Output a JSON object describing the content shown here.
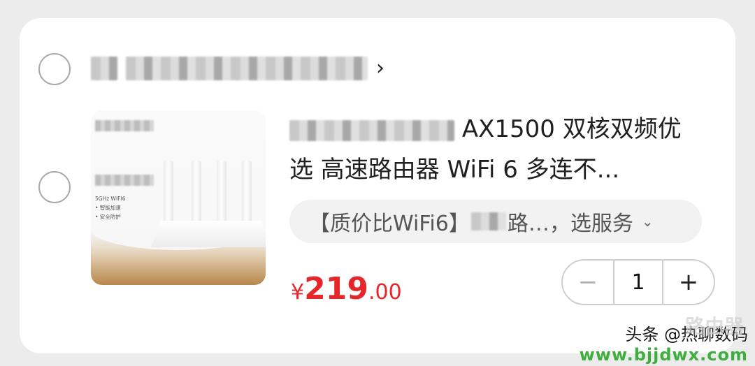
{
  "shop": {
    "chevron": "›"
  },
  "product": {
    "image_specs": [
      "5GHz WIFI6",
      "• 智能加速",
      "• 安全防护"
    ],
    "title_visible": "AX1500 双核双频优选 高速路由器 WiFi 6  多连不...",
    "title_line1": "AX1500 双核双频优",
    "title_line2": "选 高速路由器 WiFi 6  多连不...",
    "service_prefix": "【质价比WiFi6】",
    "service_suffix": "路…，选服务",
    "service_chevron": "⌄"
  },
  "price": {
    "symbol": "¥",
    "integer": "219",
    "decimal": ".00",
    "color": "#e5262b"
  },
  "quantity": {
    "minus": "−",
    "value": "1",
    "plus": "+"
  },
  "watermark": {
    "line1": "头条 @热聊数码",
    "line2": "www.bjjdwx.com",
    "logo": "路由器"
  }
}
